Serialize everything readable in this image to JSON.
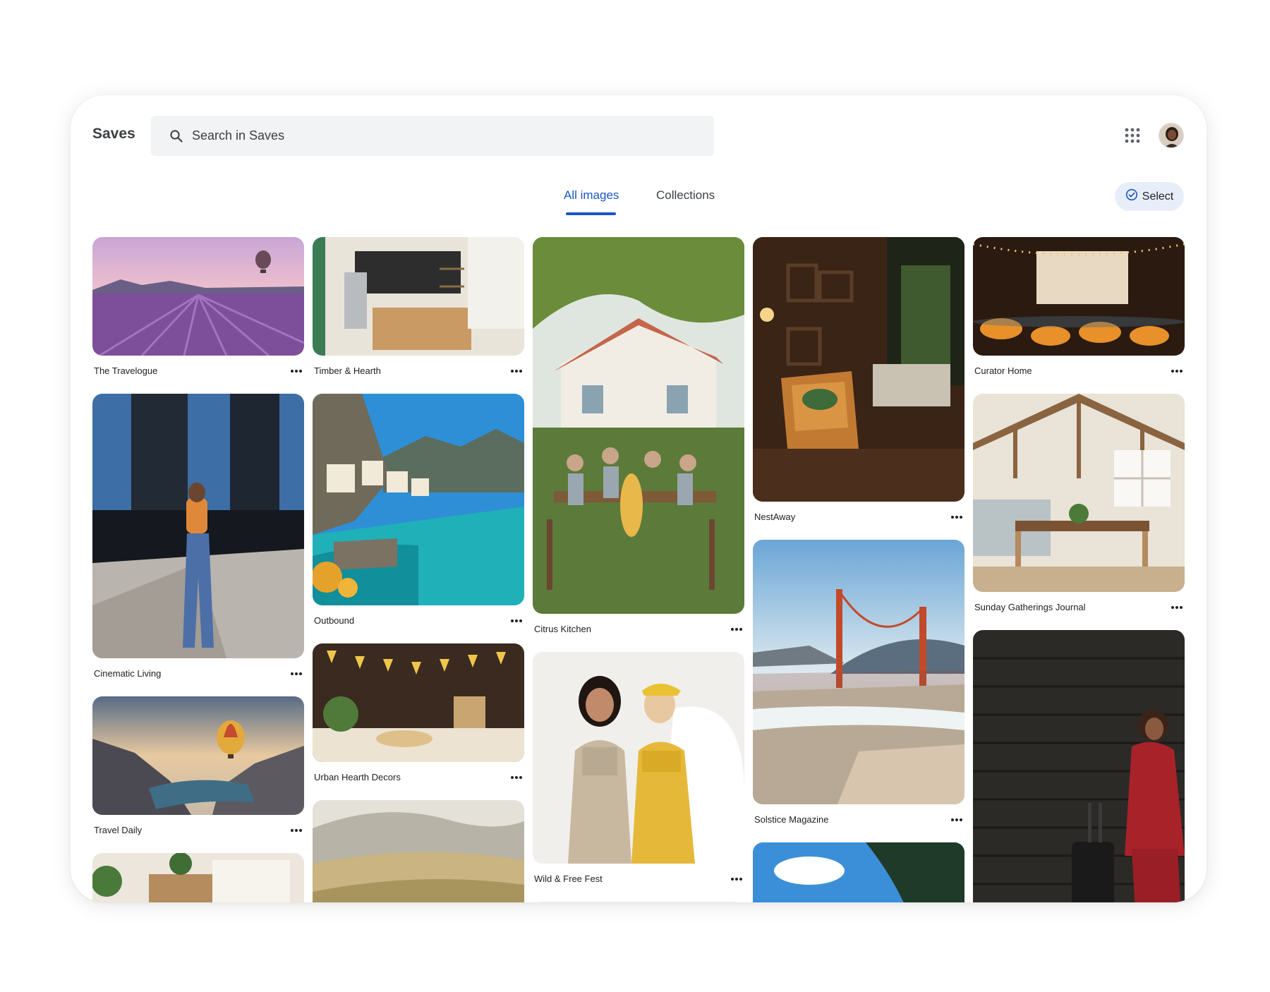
{
  "header": {
    "app_title": "Saves",
    "search_placeholder": "Search in Saves"
  },
  "tabs": [
    {
      "label": "All images",
      "active": true
    },
    {
      "label": "Collections",
      "active": false
    }
  ],
  "select_button": {
    "label": "Select"
  },
  "icons": {
    "search": "search-icon",
    "apps": "apps-grid-icon",
    "select": "check-circle-icon",
    "more": "more-horizontal-icon"
  },
  "colors": {
    "accent": "#1a56c4",
    "search_bg": "#f1f3f4",
    "select_bg": "#e8eef9"
  },
  "cards": {
    "travelogue": "The Travelogue",
    "cinematic": "Cinematic Living",
    "travel_daily": "Travel Daily",
    "timber": "Timber & Hearth",
    "outbound": "Outbound",
    "urban": "Urban Hearth Decors",
    "citrus": "Citrus Kitchen",
    "wild": "Wild & Free Fest",
    "nestaway": "NestAway",
    "solstice": "Solstice Magazine",
    "curator": "Curator Home",
    "sunday": "Sunday Gatherings Journal"
  }
}
